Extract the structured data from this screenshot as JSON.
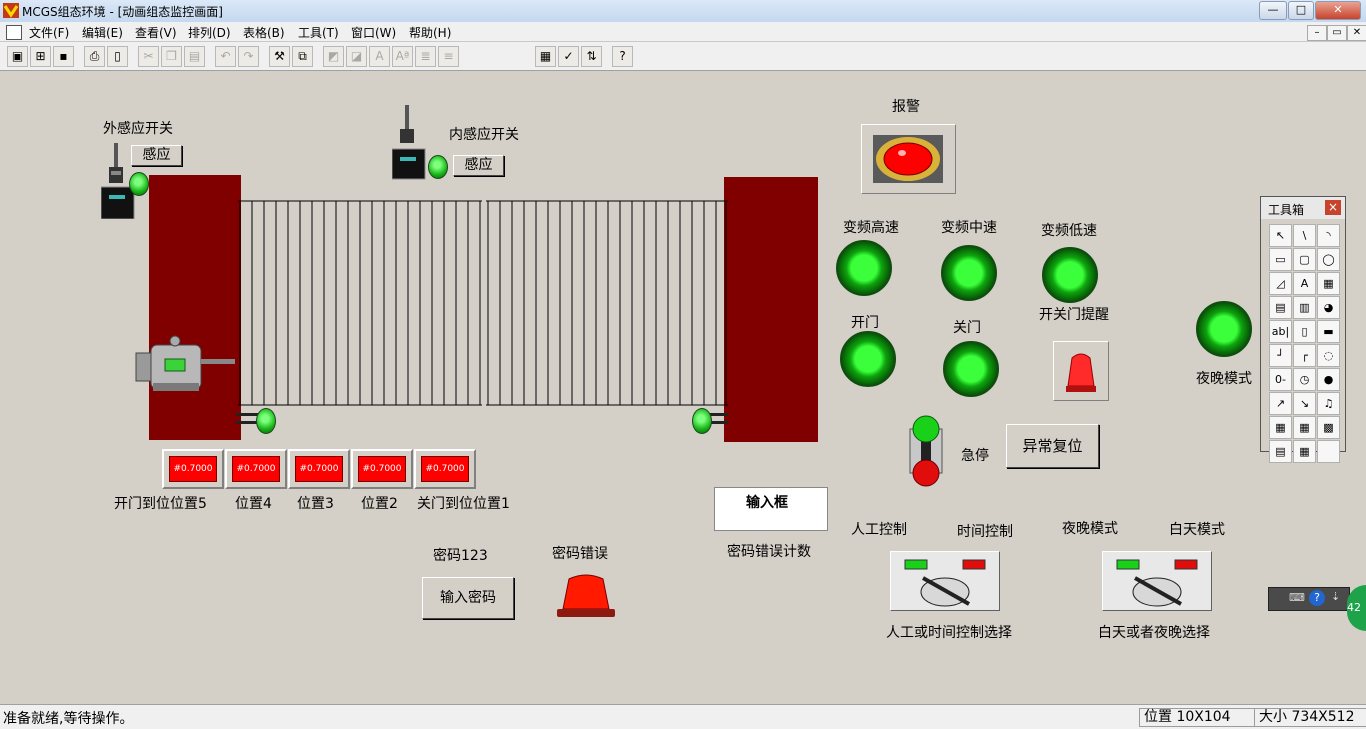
{
  "window": {
    "title": "MCGS组态环境 - [动画组态监控画面]",
    "controls": {
      "minimize": "—",
      "maximize": "□",
      "close": "✕"
    }
  },
  "menu": {
    "items": [
      "文件(F)",
      "编辑(E)",
      "查看(V)",
      "排列(D)",
      "表格(B)",
      "工具(T)",
      "窗口(W)",
      "帮助(H)"
    ],
    "mdi_controls": {
      "minimize": "–",
      "restore": "▭",
      "close": "✕"
    }
  },
  "toolbar": {
    "icons": [
      "new-window-icon",
      "open-icon",
      "save-icon",
      "print-icon",
      "print-preview-icon",
      "cut-icon",
      "copy-icon",
      "paste-icon",
      "undo-icon",
      "redo-icon",
      "tools-icon",
      "frame-icon",
      "align-icon",
      "align-icon",
      "text-icon",
      "font-icon",
      "list-icon",
      "list-icon",
      "properties-icon",
      "check-icon",
      "sort-icon",
      "help-cursor-icon"
    ]
  },
  "canvas": {
    "outer_sensor_label": "外感应开关",
    "outer_sensor_button": "感应",
    "inner_sensor_label": "内感应开关",
    "inner_sensor_button": "感应",
    "alarm_label": "报警",
    "speed_high": "变频高速",
    "speed_mid": "变频中速",
    "speed_low": "变频低速",
    "open_door": "开门",
    "close_door": "关门",
    "door_reminder": "开关门提醒",
    "night_mode_lamp": "夜晚模式",
    "estop_label": "急停",
    "reset_button": "异常复位",
    "counter_text": "#0.7000",
    "positions": [
      "开门到位位置5",
      "位置4",
      "位置3",
      "位置2",
      "关门到位位置1"
    ],
    "password_label": "密码123",
    "password_button": "输入密码",
    "password_error": "密码错误",
    "input_box": "输入框",
    "error_count": "密码错误计数",
    "manual_control": "人工控制",
    "time_control": "时间控制",
    "night_mode": "夜晚模式",
    "day_mode": "白天模式",
    "selector1_caption": "人工或时间控制选择",
    "selector2_caption": "白天或者夜晚选择"
  },
  "toolbox": {
    "title": "工具箱",
    "close": "×",
    "tools": [
      "↖",
      "\\",
      "◝",
      "▭",
      "▢",
      "◯",
      "◿",
      "A",
      "▦",
      "▤",
      "▥",
      "◕",
      "ab|",
      "▯",
      "▬",
      "┘",
      "┌",
      "◌",
      "0-",
      "◷",
      "●",
      "↗",
      "↘",
      "♫",
      "▦",
      "▦",
      "▩",
      "▤",
      "▦",
      ""
    ]
  },
  "floating": {
    "badge": "42"
  },
  "status": {
    "message": "准备就绪,等待操作。",
    "position": "位置 10X104",
    "size": "大小 734X512"
  },
  "colors": {
    "gate_post": "#800000",
    "lamp_green": "#1fcf1f",
    "alarm_red": "#ff0000",
    "canvas_bg": "#d4d0c8"
  }
}
